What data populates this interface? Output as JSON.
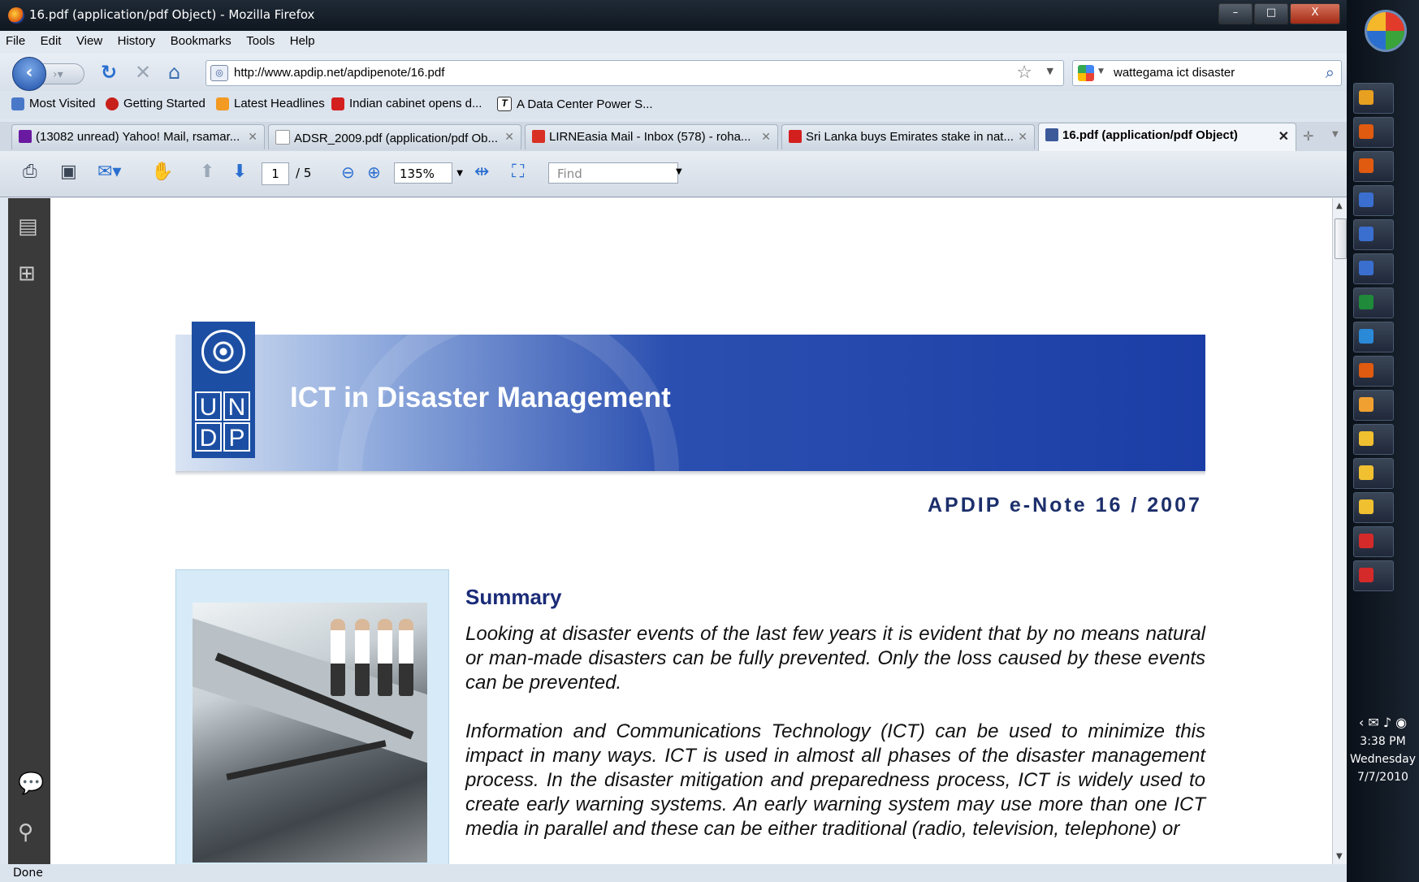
{
  "window": {
    "title": "16.pdf (application/pdf Object) - Mozilla Firefox",
    "controls": {
      "minimize": "–",
      "maximize": "□",
      "close": "X"
    }
  },
  "menu": [
    "File",
    "Edit",
    "View",
    "History",
    "Bookmarks",
    "Tools",
    "Help"
  ],
  "nav": {
    "url": "http://www.apdip.net/apdipenote/16.pdf",
    "search_query": "wattegama ict disaster"
  },
  "bookmarks": [
    {
      "label": "Most Visited",
      "color": "#4a78c8"
    },
    {
      "label": "Getting Started",
      "color": "#c8201a"
    },
    {
      "label": "Latest Headlines",
      "color": "#f29a22"
    },
    {
      "label": "Indian cabinet opens d...",
      "color": "#d41f1f"
    },
    {
      "label": "A Data Center Power S...",
      "color": "#222222"
    }
  ],
  "tabs": [
    {
      "label": "(13082 unread) Yahoo! Mail, rsamar...",
      "icon_color": "#6a1aa0",
      "active": false
    },
    {
      "label": "ADSR_2009.pdf (application/pdf Ob...",
      "icon_color": "#ffffff",
      "active": false
    },
    {
      "label": "LIRNEasia Mail - Inbox (578) - roha...",
      "icon_color": "#d93025",
      "active": false
    },
    {
      "label": "Sri Lanka buys Emirates stake in nat...",
      "icon_color": "#d41f1f",
      "active": false
    },
    {
      "label": "16.pdf (application/pdf Object)",
      "icon_color": "#3c5a9a",
      "active": true
    }
  ],
  "pdf_toolbar": {
    "page_current": "1",
    "page_total": "/ 5",
    "zoom": "135%",
    "find_placeholder": "Find"
  },
  "document": {
    "banner_title": "ICT in Disaster Management",
    "logo_letters": [
      "U",
      "N",
      "D",
      "P"
    ],
    "enote": "APDIP e-Note 16 / 2007",
    "summary_heading": "Summary",
    "para1": "Looking at disaster events of the last few years it is evident that by no means natural or man-made disasters can be fully prevented. Only the loss caused by these events can be prevented.",
    "para2": "Information and Communications Technology (ICT) can be used to minimize this impact in many ways. ICT is used in almost all phases of the disaster management process. In the disaster mitigation and preparedness process, ICT is widely used to create early warning systems. An early warning system may use more than one ICT media in parallel and these can be either traditional (radio, television, telephone) or"
  },
  "status": "Done",
  "taskbar": {
    "time": "3:38 PM",
    "day": "Wednesday",
    "date": "7/7/2010",
    "button_colors": [
      "#e8a020",
      "#e05a10",
      "#e05a10",
      "#3a6fd0",
      "#3a6fd0",
      "#3a6fd0",
      "#1e8a3a",
      "#2a8ad8",
      "#e05a10",
      "#f0a030",
      "#f0c030",
      "#f0c030",
      "#f0c030",
      "#d42a2a",
      "#d42a2a"
    ]
  }
}
